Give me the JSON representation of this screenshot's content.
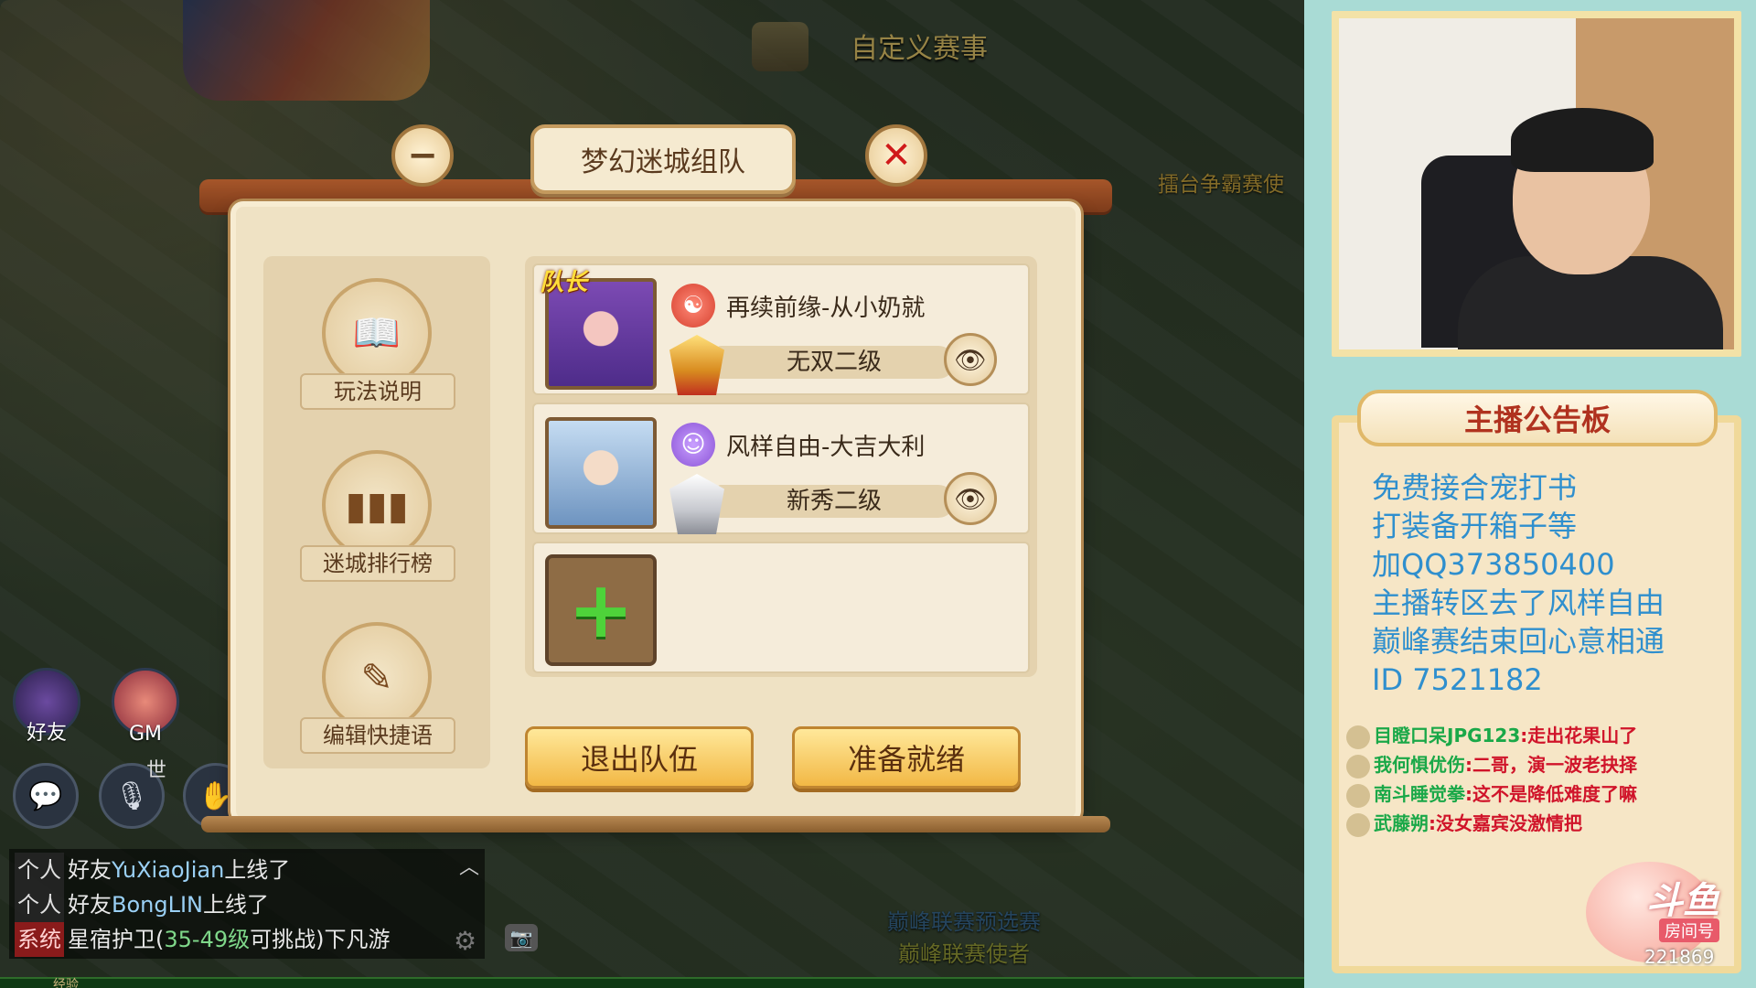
{
  "game": {
    "top_event": "自定义赛事",
    "npc_label": "擂台争霸赛使",
    "bottom_labels": [
      "巅峰联赛预选赛",
      "巅峰联赛使者"
    ],
    "friends_label": "好友",
    "gm_label": "GM",
    "world_label": "世",
    "exp_label": "经验"
  },
  "chat": {
    "lines": [
      {
        "tag": "个人",
        "prefix": "好友",
        "name": "YuXiaoJian",
        "suffix": "上线了"
      },
      {
        "tag": "个人",
        "prefix": "好友",
        "name": "BongLIN",
        "suffix": "上线了"
      },
      {
        "tag": "系统",
        "prefix": "星宿护卫(",
        "name": "35-49级",
        "suffix": "可挑战)下凡游"
      }
    ]
  },
  "dialog": {
    "title": "梦幻迷城组队",
    "menu": [
      {
        "label": "玩法说明",
        "icon": "book-icon"
      },
      {
        "label": "迷城排行榜",
        "icon": "bar-chart-icon"
      },
      {
        "label": "编辑快捷语",
        "icon": "pencil-icon"
      }
    ],
    "captain_tag": "队长",
    "members": [
      {
        "name": "再续前缘-从小奶就",
        "rank": "无双二级",
        "faction_icon": "tiangong-faction-icon",
        "badge_color": "#e8a02a"
      },
      {
        "name": "风样自由-大吉大利",
        "rank": "新秀二级",
        "faction_icon": "ghost-faction-icon",
        "badge_color": "#c7c9cf"
      }
    ],
    "leave_button": "退出队伍",
    "ready_button": "准备就绪"
  },
  "sidebar": {
    "board_title": "主播公告板",
    "board_lines": [
      "免费接合宠打书",
      "打装备开箱子等",
      "加QQ373850400",
      "主播转区去了风样自由",
      "巅峰赛结束回心意相通",
      "ID 7521182"
    ],
    "danmaku": [
      {
        "name": "目瞪口呆JPG123",
        "msg": "走出花果山了"
      },
      {
        "name": "我何惧优伤",
        "msg": "二哥，演一波老抉择"
      },
      {
        "name": "南斗睡觉拳",
        "msg": "这不是降低难度了嘛"
      },
      {
        "name": "武藤朔",
        "msg": "没女嘉宾没激情把"
      }
    ],
    "mascot_logo": "斗鱼",
    "room_label": "房间号",
    "room_number": "221869"
  }
}
